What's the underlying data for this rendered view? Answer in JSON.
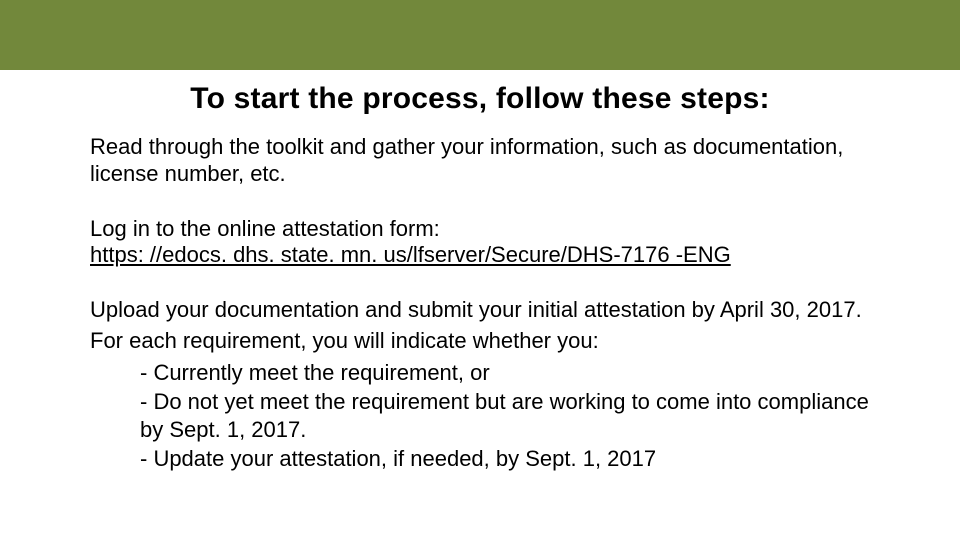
{
  "title": "To start the process, follow these steps:",
  "step1": "Read through the toolkit and gather your information, such as documentation, license number, etc.",
  "step2_intro": "Log in to the online attestation form:",
  "step2_link": "https: //edocs. dhs. state. mn. us/lfserver/Secure/DHS-7176 -ENG",
  "step3_line1": "Upload your documentation and submit your initial attestation by April 30, 2017.",
  "step3_line2": "For each requirement, you will indicate whether you:",
  "step3_bullet1": "- Currently meet the requirement, or",
  "step3_bullet2": "- Do not yet meet the requirement but are working to come into compliance by Sept. 1, 2017.",
  "step3_bullet3": "- Update your attestation, if needed, by Sept. 1, 2017"
}
